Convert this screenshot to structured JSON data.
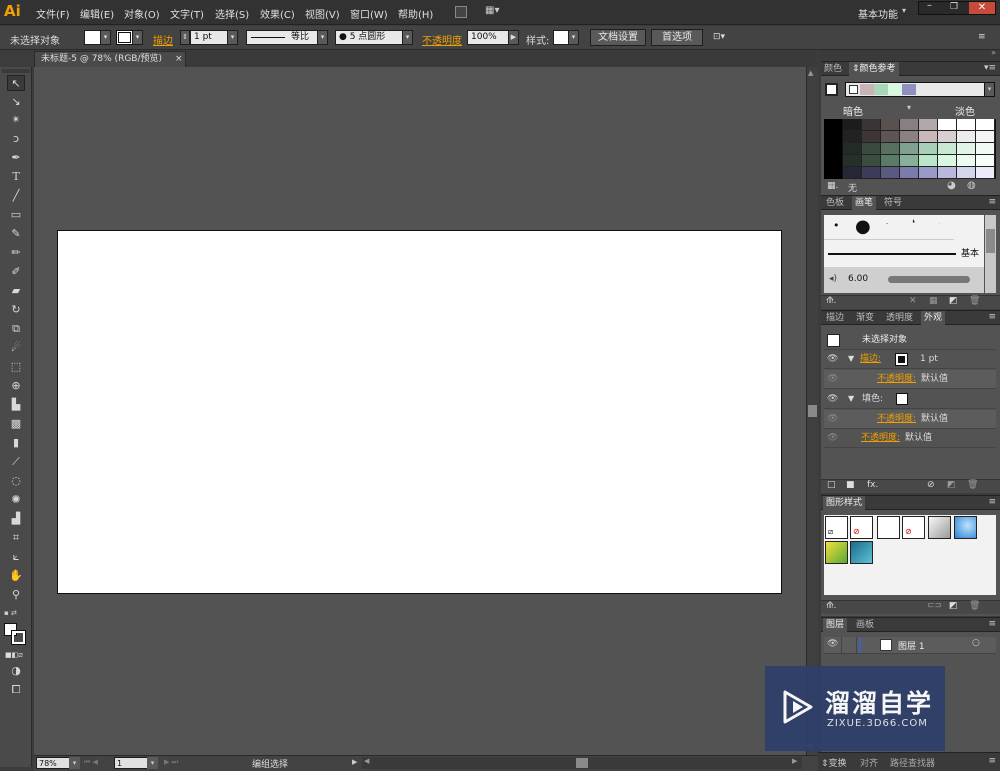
{
  "menubar": {
    "logo": "Ai",
    "items": [
      "文件(F)",
      "编辑(E)",
      "对象(O)",
      "文字(T)",
      "选择(S)",
      "效果(C)",
      "视图(V)",
      "窗口(W)",
      "帮助(H)"
    ],
    "workspace": "基本功能"
  },
  "control": {
    "selection_label": "未选择对象",
    "stroke_label": "描边",
    "stroke_value": "1 pt",
    "stroke_profile": "等比",
    "brush": "5 点圆形",
    "opacity_label": "不透明度",
    "opacity_value": "100%",
    "style_label": "样式:",
    "doc_setup": "文档设置",
    "preferences": "首选项"
  },
  "document": {
    "tab_title": "未标题-5 @ 78% (RGB/预览)",
    "close": "×"
  },
  "statusbar": {
    "zoom": "78%",
    "artboard": "1",
    "status": "编组选择"
  },
  "color_panel": {
    "tabs": [
      "颜色",
      "颜色参考"
    ],
    "dark_label": "暗色",
    "light_label": "淡色",
    "none_label": "无",
    "swatch_colors": [
      "#c8b4b4",
      "#a8d8b8",
      "#d8f8e0",
      "#9090c0"
    ]
  },
  "brush_panel": {
    "tabs": [
      "色板",
      "画笔",
      "符号"
    ],
    "basic_label": "基本",
    "size_label": "6.00"
  },
  "appearance_panel": {
    "tabs": [
      "描边",
      "渐变",
      "透明度",
      "外观"
    ],
    "title": "未选择对象",
    "rows": [
      {
        "label": "描边:",
        "value": "1 pt"
      },
      {
        "label": "不透明度:",
        "value": "默认值"
      },
      {
        "label": "填色:",
        "value": ""
      },
      {
        "label": "不透明度:",
        "value": "默认值"
      },
      {
        "label": "不透明度:",
        "value": "默认值"
      }
    ]
  },
  "graphic_styles_panel": {
    "tabs": [
      "图形样式"
    ]
  },
  "layers_panel": {
    "tabs": [
      "图层",
      "画板"
    ],
    "layer_name": "图层 1"
  },
  "bottom_tabs": [
    "变换",
    "对齐",
    "路径查找器"
  ],
  "watermark": {
    "title": "溜溜自学",
    "url": "ZIXUE.3D66.COM"
  },
  "colors": {
    "accent_orange": "#f0a000",
    "layer_blue": "#4060c0",
    "watermark_bg": "#2f3f6a"
  }
}
